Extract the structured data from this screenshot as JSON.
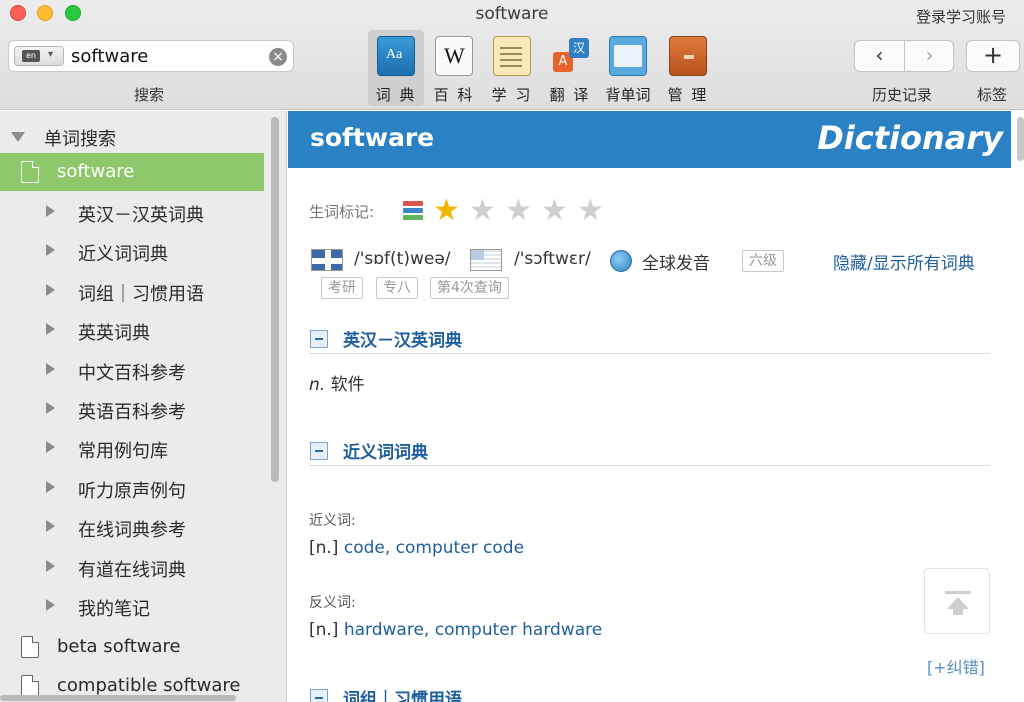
{
  "window": {
    "title": "software",
    "login_label": "登录学习账号"
  },
  "search": {
    "lang": "en",
    "value": "software",
    "label": "搜索"
  },
  "toolbar": {
    "tools": [
      {
        "label": "词 典",
        "icon": "dictionary-icon",
        "active": true
      },
      {
        "label": "百 科",
        "icon": "wikipedia-icon",
        "active": false
      },
      {
        "label": "学 习",
        "icon": "notepad-icon",
        "active": false
      },
      {
        "label": "翻 译",
        "icon": "translate-icon",
        "active": false
      },
      {
        "label": "背单词",
        "icon": "wordbook-icon",
        "active": false
      },
      {
        "label": "管 理",
        "icon": "cabinet-icon",
        "active": false
      }
    ],
    "translate_icon_glyphs": {
      "zh": "汉",
      "en": "A"
    },
    "history_label": "历史记录",
    "tags_label": "标签",
    "add_glyph": "+",
    "back_glyph": "‹",
    "forward_glyph": "›"
  },
  "sidebar": {
    "root_label": "单词搜索",
    "selected": "software",
    "dict_items": [
      "英汉－汉英词典",
      "近义词词典",
      "词组｜习惯用语",
      "英英词典",
      "中文百科参考",
      "英语百科参考",
      "常用例句库",
      "听力原声例句",
      "在线词典参考",
      "有道在线词典",
      "我的笔记"
    ],
    "other_words": [
      "beta software",
      "compatible software"
    ]
  },
  "entry": {
    "word": "software",
    "brand": "Dictionary",
    "mark_label": "生词标记:",
    "rating": 1,
    "rating_max": 5,
    "uk_phonetic": "/'sɒf(t)weə/",
    "us_phonetic": "/'sɔftwɛr/",
    "global_pron": "全球发音",
    "tags": [
      "六级",
      "考研",
      "专八",
      "第4次查询"
    ],
    "toggle_all": "隐藏/显示所有词典",
    "sections": {
      "ec_title": "英汉－汉英词典",
      "ec_pos": "n.",
      "ec_def": " 软件",
      "syn_title": "近义词词典",
      "syn_label": "近义词:",
      "syn_pos": "[n.] ",
      "syn_words": "code, computer code",
      "ant_label": "反义词:",
      "ant_pos": "[n.] ",
      "ant_words": "hardware, computer hardware",
      "phrase_title": "词组｜习惯用语"
    },
    "report_error": "[+纠错]"
  },
  "colors": {
    "accent_blue": "#2a81c4",
    "selected_green": "#8dc86a",
    "link_blue": "#1f5e9e",
    "star_gold": "#f4b400"
  }
}
